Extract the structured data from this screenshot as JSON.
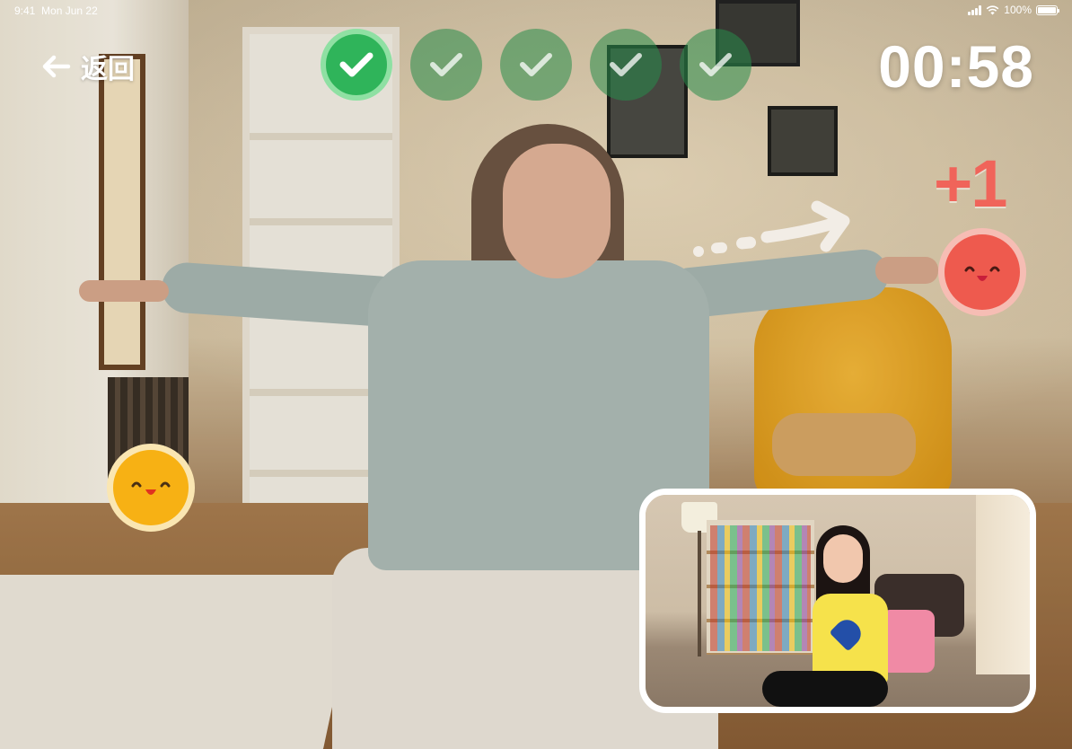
{
  "status_bar": {
    "time": "9:41",
    "date": "Mon Jun 22",
    "battery": "100%"
  },
  "nav": {
    "back_label": "返回"
  },
  "progress": {
    "steps": [
      {
        "state": "done"
      },
      {
        "state": "pending"
      },
      {
        "state": "pending"
      },
      {
        "state": "pending"
      },
      {
        "state": "pending"
      }
    ],
    "completed": 1,
    "total": 5
  },
  "timer": {
    "value": "00:58"
  },
  "score": {
    "gain": "+1"
  },
  "targets": {
    "red": {
      "color": "#ee5a4e"
    },
    "yellow": {
      "color": "#f7b114"
    }
  },
  "colors": {
    "accent_green": "#2fb45a",
    "accent_red": "#f0645a",
    "accent_yellow": "#f7b114"
  },
  "icons": {
    "back": "arrow-left-icon",
    "check": "check-icon",
    "signal": "signal-icon",
    "wifi": "wifi-icon",
    "battery": "battery-icon"
  }
}
